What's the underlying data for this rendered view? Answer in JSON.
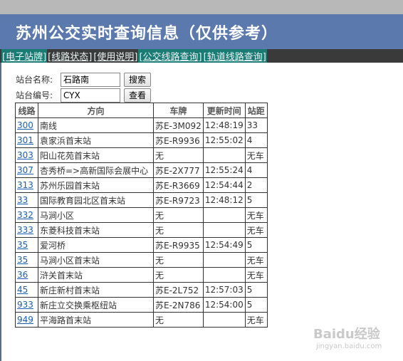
{
  "header": {
    "title": "苏州公交实时查询信息（仅供参考）"
  },
  "nav": {
    "items": [
      {
        "label": "[电子站牌]",
        "highlight": true
      },
      {
        "label": "[线路状态]",
        "highlight": false
      },
      {
        "label": "[使用说明]",
        "highlight": false
      },
      {
        "label": "[公交线路查询]",
        "highlight": true
      },
      {
        "label": "[轨道线路查询]",
        "highlight": true
      }
    ]
  },
  "form": {
    "station_name_label": "站台名称:",
    "station_name_value": "石路南",
    "search_button": "搜索",
    "station_code_label": "站台编号:",
    "station_code_value": "CYX",
    "view_button": "查看"
  },
  "table": {
    "headers": [
      "线路",
      "方向",
      "车牌",
      "更新时间",
      "站距"
    ],
    "rows": [
      [
        "300",
        "南线",
        "苏E-3M092",
        "12:48:19",
        "33"
      ],
      [
        "301",
        "袁家浜首末站",
        "苏E-R9936",
        "12:55:02",
        "4"
      ],
      [
        "303",
        "阳山花苑首末站",
        "无",
        "",
        "无车"
      ],
      [
        "307",
        "杏秀桥=>高新国际会展中心",
        "苏E-2X777",
        "12:55:24",
        "4"
      ],
      [
        "313",
        "苏州乐园首末站",
        "苏E-R3669",
        "12:54:44",
        "2"
      ],
      [
        "33",
        "国际教育园北区首末站",
        "苏E-R9723",
        "12:48:12",
        "5"
      ],
      [
        "332",
        "马涧小区",
        "无",
        "",
        "无车"
      ],
      [
        "333",
        "东菱科技首末站",
        "无",
        "",
        "无车"
      ],
      [
        "35",
        "爱河桥",
        "苏E-R9935",
        "12:54:49",
        "5"
      ],
      [
        "35",
        "马涧小区首末站",
        "无",
        "",
        "无车"
      ],
      [
        "36",
        "浒关首末站",
        "无",
        "",
        "无车"
      ],
      [
        "45",
        "新庄新村首末站",
        "苏E-2L752",
        "12:57:03",
        "5"
      ],
      [
        "933",
        "新庄立交换乘枢纽站",
        "苏E-2N786",
        "12:54:00",
        "5"
      ],
      [
        "949",
        "平海路首末站",
        "无",
        "",
        "无车"
      ]
    ]
  },
  "watermark": {
    "logo": "Baidu经验",
    "url": "jingyan.baidu.com"
  }
}
